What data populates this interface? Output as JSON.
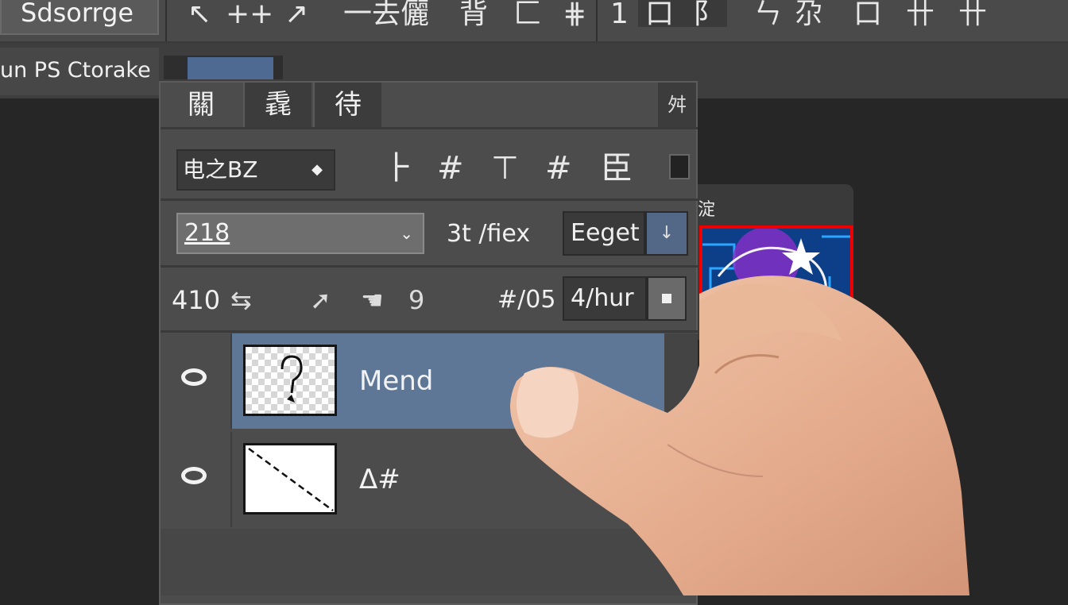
{
  "toolbar": {
    "app_title": "Sdsorrge",
    "icons": [
      {
        "name": "move-tool-icon",
        "glyph": "↖"
      },
      {
        "name": "add-tool-icon",
        "glyph": "++"
      },
      {
        "name": "pen-tool-icon",
        "glyph": "↗"
      },
      {
        "name": "text-tool-icon",
        "glyph": "一去儷"
      },
      {
        "name": "align-tool-icon",
        "glyph": "背"
      },
      {
        "name": "corner-tool-icon",
        "glyph": "匚"
      },
      {
        "name": "grid-tool-icon",
        "glyph": "⋕"
      },
      {
        "name": "bar-tool-icon",
        "glyph": "1"
      },
      {
        "name": "rect-tool-icon",
        "glyph": "口"
      },
      {
        "name": "crop-tool-icon",
        "glyph": "阝"
      },
      {
        "name": "lasso-tool-icon",
        "glyph": "ㄣ"
      },
      {
        "name": "brush-tool-icon",
        "glyph": "尕"
      },
      {
        "name": "frame-tool-icon",
        "glyph": "口"
      },
      {
        "name": "hash-tool-icon",
        "glyph": "卄"
      },
      {
        "name": "hash2-tool-icon",
        "glyph": "卄"
      }
    ]
  },
  "document_tab": {
    "label": "un PS Ctorake"
  },
  "panel": {
    "tabs": [
      {
        "label": "關"
      },
      {
        "label": "毳"
      },
      {
        "label": "待"
      }
    ],
    "menu_icon": "舛",
    "blend_mode": {
      "value": "电之BZ",
      "caret": "◆"
    },
    "lock_icons": [
      {
        "name": "lock-pixels-icon",
        "glyph": "⺊"
      },
      {
        "name": "lock-position-icon",
        "glyph": "#"
      },
      {
        "name": "lock-artboard-icon",
        "glyph": "⊤"
      },
      {
        "name": "lock-all-icon",
        "glyph": "#"
      },
      {
        "name": "lock-fill-icon",
        "glyph": "臣"
      }
    ],
    "opacity": {
      "value": "218",
      "caret": "⌄"
    },
    "fill_label": "3t /fiex",
    "edge": {
      "value": "Eeget",
      "button_glyph": "↓"
    },
    "row3": {
      "value": "410",
      "size_label": "#/05",
      "hur_value": "4/hur"
    },
    "row3_icons": [
      {
        "name": "arrows-icon",
        "glyph": "⇆"
      },
      {
        "name": "arrow-icon",
        "glyph": "➚"
      },
      {
        "name": "hand-icon",
        "glyph": "☚"
      },
      {
        "name": "nine-icon",
        "glyph": "9"
      }
    ]
  },
  "layers": [
    {
      "name": "Mend",
      "selected": true
    },
    {
      "name": "Δ#",
      "selected": false
    }
  ],
  "canvas": {
    "title": "淀"
  },
  "colors": {
    "selected_layer": "#5f7797",
    "accent_button": "#536886",
    "canvas_border": "#ee0000"
  }
}
